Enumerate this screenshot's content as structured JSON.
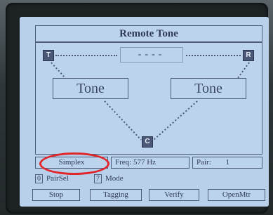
{
  "screen": {
    "title": "Remote Tone",
    "center_display": "----",
    "nodes": {
      "left": "T",
      "right": "R",
      "bottom": "C"
    },
    "tone_left": "Tone",
    "tone_right": "Tone",
    "status": {
      "mode": "Simplex",
      "freq": "Freq: 577 Hz",
      "pair_label": "Pair:",
      "pair_value": "1"
    },
    "shortcuts": [
      {
        "key": "0",
        "label": "PairSel"
      },
      {
        "key": "7",
        "label": "Mode"
      }
    ],
    "softkeys": [
      "Stop",
      "Tagging",
      "Verify",
      "OpenMtr"
    ]
  },
  "colors": {
    "screen_bg": "#b8d0ea",
    "highlight_ellipse": "#e0262a"
  }
}
